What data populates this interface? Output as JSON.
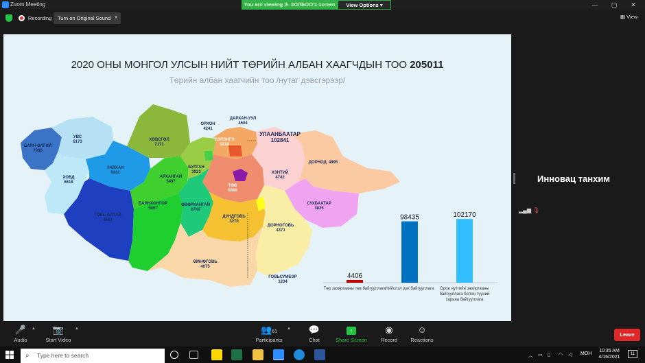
{
  "window": {
    "title": "Zoom Meeting",
    "minimize": "—",
    "maximize": "▢",
    "close": "✕"
  },
  "banner": {
    "viewing": "You are viewing Э. ЗОЛБОО's screen",
    "view_options": "View Options ▾"
  },
  "toolbar": {
    "recording": "Recording",
    "original_sound": "Turn on Original Sound",
    "view": "▦ View"
  },
  "slide": {
    "title": "2020 ОНЫ МОНГОЛ УЛСЫН НИЙТ ТӨРИЙН АЛБАН ХААГЧДЫН ТОО ",
    "title_total": "205011",
    "subtitle": "Төрийн албан хаагчийн тоо /нутаг дэвсгэрээр/"
  },
  "regions": [
    {
      "name": "УВС",
      "value": "6173"
    },
    {
      "name": "БАЯН-ӨЛГИЙ",
      "value": "7068"
    },
    {
      "name": "ХОВД",
      "value": "6618"
    },
    {
      "name": "ЗАВХАН",
      "value": "5331"
    },
    {
      "name": "ХӨВСГӨЛ",
      "value": "7171"
    },
    {
      "name": "ГОВЬ-АЛТАЙ",
      "value": "4661"
    },
    {
      "name": "АРХАНГАЙ",
      "value": "5497"
    },
    {
      "name": "БУЛГАН",
      "value": "3923"
    },
    {
      "name": "ОРХОН",
      "value": "4241"
    },
    {
      "name": "ДАРХАН-УУЛ",
      "value": "4504"
    },
    {
      "name": "СЭЛЭНГЭ",
      "value": "5218"
    },
    {
      "name": "УЛААНБААТАР",
      "value": "102841"
    },
    {
      "name": "ТӨВ",
      "value": "5560"
    },
    {
      "name": "ХЭНТИЙ",
      "value": "4742"
    },
    {
      "name": "ДОРНОД",
      "value": "4995"
    },
    {
      "name": "СҮХБААТАР",
      "value": "3825"
    },
    {
      "name": "БАЯНХОНГОР",
      "value": "5067"
    },
    {
      "name": "ӨВӨРХАНГАЙ",
      "value": "6734"
    },
    {
      "name": "ДУНДГОВЬ",
      "value": "3270"
    },
    {
      "name": "ДОРНОГОВЬ",
      "value": "4371"
    },
    {
      "name": "ӨМНӨГОВЬ",
      "value": "4075"
    },
    {
      "name": "ГОВЬСҮМБЭР",
      "value": "1234"
    }
  ],
  "chart_data": {
    "type": "bar",
    "categories": [
      "Төр захиргааны төв байгууллага",
      "Нийслэл дэх байгууллага",
      "Орон нутгийн захиргааны байгууллага болон түүний харьяа байгууллага"
    ],
    "values": [
      4406,
      98435,
      102170
    ],
    "colors": [
      "#c00000",
      "#0070c0",
      "#33bfff"
    ],
    "ylim": [
      0,
      110000
    ]
  },
  "speaker": {
    "name": "Инновац танхим"
  },
  "controls": {
    "audio": "Audio",
    "start_video": "Start Video",
    "participants": "Participants",
    "participants_count": "61",
    "chat": "Chat",
    "share_screen": "Share Screen",
    "record": "Record",
    "reactions": "Reactions",
    "leave": "Leave"
  },
  "taskbar": {
    "search_placeholder": "Type here to search",
    "language": "МОН",
    "time": "10:35 AM",
    "date": "4/16/2021",
    "notifications": "11"
  },
  "colors": {
    "zoom_blue": "#2d8cff",
    "share_green": "#23c343",
    "leave_red": "#e02828"
  }
}
